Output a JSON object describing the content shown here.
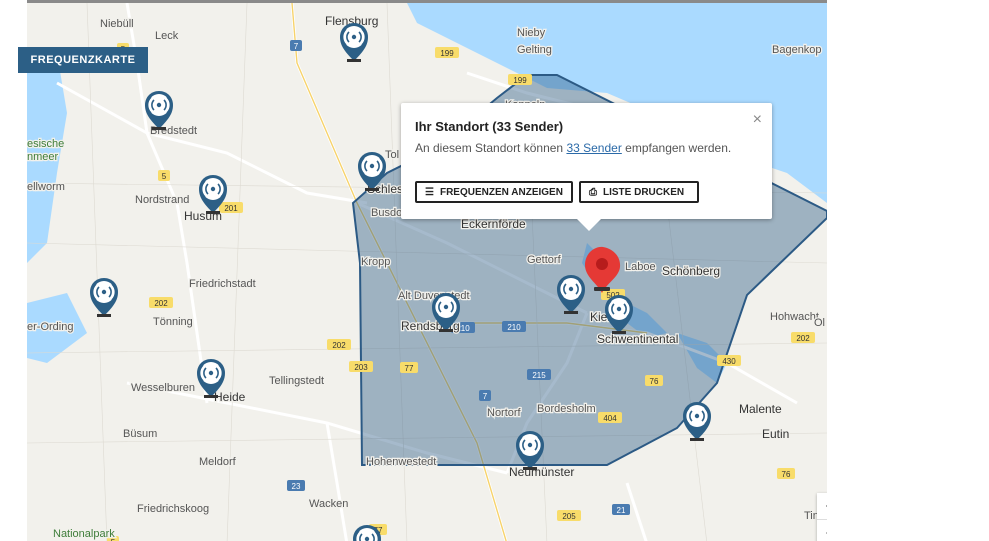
{
  "tab_label": "FREQUENZKARTE",
  "popup": {
    "title": "Ihr Standort (33 Sender)",
    "text_before": "An diesem Standort können ",
    "link_text": "33 Sender",
    "text_after": " empfangen werden.",
    "close": "×",
    "button_frequencies": "FREQUENZEN ANZEIGEN",
    "button_print": "LISTE DRUCKEN"
  },
  "zoom": {
    "in": "+",
    "out": "−"
  },
  "colors": {
    "coverage_fill": "#2c5a85",
    "marker": "#2c5f86",
    "location_pin": "#e53935",
    "water": "#aadaff"
  },
  "places": [
    {
      "name": "Flensburg",
      "bold": true
    },
    {
      "name": "Niebüll"
    },
    {
      "name": "Leck"
    },
    {
      "name": "Nieby"
    },
    {
      "name": "Gelting"
    },
    {
      "name": "Bagenkop"
    },
    {
      "name": "Bredstedt"
    },
    {
      "name": "Nordstrand"
    },
    {
      "name": "Husum",
      "bold": true
    },
    {
      "name": "Schleswig",
      "bold": true
    },
    {
      "name": "Busdorf"
    },
    {
      "name": "Eckernförde",
      "bold": true
    },
    {
      "name": "Gettorf"
    },
    {
      "name": "Kropp"
    },
    {
      "name": "Friedrichstadt"
    },
    {
      "name": "Alt Duvenstedt"
    },
    {
      "name": "Rendsburg",
      "bold": true
    },
    {
      "name": "Kiel",
      "bold": true
    },
    {
      "name": "Schwentinental",
      "bold": true
    },
    {
      "name": "Schönberg",
      "bold": true
    },
    {
      "name": "Hohwacht"
    },
    {
      "name": "Tönning"
    },
    {
      "name": "Wesselburen"
    },
    {
      "name": "Heide",
      "bold": true
    },
    {
      "name": "Tellingstedt"
    },
    {
      "name": "Nortorf"
    },
    {
      "name": "Bordesholm"
    },
    {
      "name": "Malente",
      "bold": true
    },
    {
      "name": "Eutin",
      "bold": true
    },
    {
      "name": "Büsum"
    },
    {
      "name": "Meldorf"
    },
    {
      "name": "Hohenwestedt"
    },
    {
      "name": "Neumünster",
      "bold": true
    },
    {
      "name": "Wacken"
    },
    {
      "name": "Friedrichskoog"
    },
    {
      "name": "Nationalpark",
      "green": true
    },
    {
      "name": "esische",
      "green": true
    },
    {
      "name": "nmeer",
      "green": true
    },
    {
      "name": "ellworm"
    },
    {
      "name": "er-Ording"
    },
    {
      "name": "Tol"
    },
    {
      "name": "Kappeln"
    },
    {
      "name": "Laboe"
    },
    {
      "name": "Ol"
    },
    {
      "name": "Tin"
    }
  ],
  "roads": [
    "5",
    "7",
    "199",
    "199",
    "5",
    "201",
    "202",
    "202",
    "203",
    "77",
    "210",
    "210",
    "215",
    "7",
    "404",
    "502",
    "76",
    "430",
    "202",
    "76",
    "23",
    "205",
    "21",
    "77",
    "5"
  ]
}
